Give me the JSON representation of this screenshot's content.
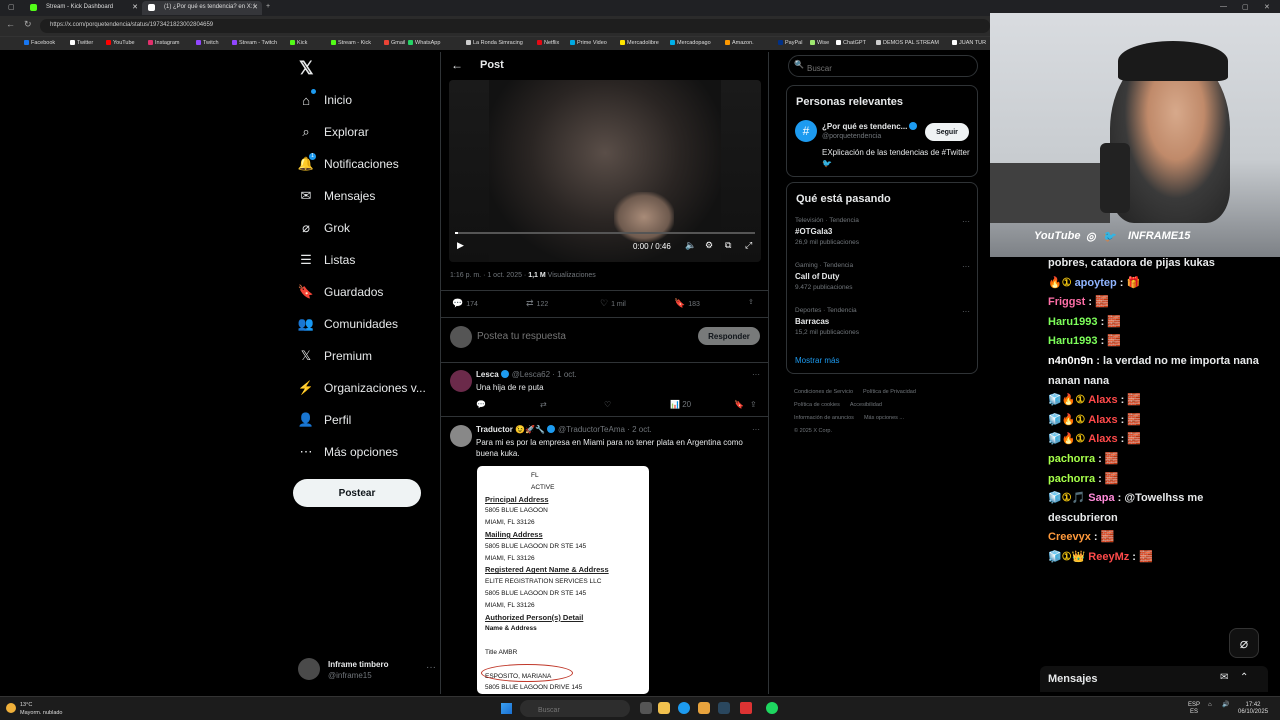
{
  "browser": {
    "tabs": [
      {
        "title": "Stream - Kick Dashboard",
        "favicon_color": "#53fc18"
      },
      {
        "title": "(1) ¿Por qué es tendencia? en X: '",
        "favicon_color": "#ffffff"
      }
    ],
    "url": "https://x.com/porquetendencia/status/1973421823002804659",
    "bookmarks": [
      {
        "label": "Facebook",
        "color": "#1877f2"
      },
      {
        "label": "Twitter",
        "color": "#ffffff"
      },
      {
        "label": "YouTube",
        "color": "#ff0000"
      },
      {
        "label": "Instagram",
        "color": "#e1306c"
      },
      {
        "label": "Twitch",
        "color": "#9146ff"
      },
      {
        "label": "Stream - Twitch",
        "color": "#9146ff"
      },
      {
        "label": "Kick",
        "color": "#53fc18"
      },
      {
        "label": "Stream - Kick",
        "color": "#53fc18"
      },
      {
        "label": "Gmail",
        "color": "#ea4335"
      },
      {
        "label": "WhatsApp",
        "color": "#25d366"
      },
      {
        "label": "La Ronda Simracing",
        "color": "#cccccc"
      },
      {
        "label": "Netflix",
        "color": "#e50914"
      },
      {
        "label": "Prime Video",
        "color": "#00a8e1"
      },
      {
        "label": "Mercadolibre",
        "color": "#ffe600"
      },
      {
        "label": "Mercadopago",
        "color": "#00b1ea"
      },
      {
        "label": "Amazon.",
        "color": "#ff9900"
      },
      {
        "label": "PayPal",
        "color": "#003087"
      },
      {
        "label": "Wise",
        "color": "#9fe870"
      },
      {
        "label": "ChatGPT",
        "color": "#ffffff"
      },
      {
        "label": "DEMOS PAL STREAM",
        "color": "#cccccc"
      },
      {
        "label": "JUAN TUR",
        "color": "#ffffff"
      }
    ]
  },
  "x_nav": {
    "items": [
      {
        "label": "Inicio",
        "icon": "home-icon"
      },
      {
        "label": "Explorar",
        "icon": "search-icon"
      },
      {
        "label": "Notificaciones",
        "icon": "bell-icon"
      },
      {
        "label": "Mensajes",
        "icon": "mail-icon"
      },
      {
        "label": "Grok",
        "icon": "grok-icon"
      },
      {
        "label": "Listas",
        "icon": "list-icon"
      },
      {
        "label": "Guardados",
        "icon": "bookmark-icon"
      },
      {
        "label": "Comunidades",
        "icon": "people-icon"
      },
      {
        "label": "Premium",
        "icon": "x-icon"
      },
      {
        "label": "Organizaciones v...",
        "icon": "lightning-icon"
      },
      {
        "label": "Perfil",
        "icon": "person-icon"
      },
      {
        "label": "Más opciones",
        "icon": "more-icon"
      }
    ],
    "notif_badge": "1",
    "post_button": "Postear",
    "account": {
      "name": "Inframe timbero",
      "handle": "@inframe15"
    }
  },
  "post": {
    "header_title": "Post",
    "video_time": "0:00 / 0:46",
    "video_progress": 0.0,
    "time_meta": "1:16 p. m. · 1 oct. 2025 · ",
    "views": "1,1 M",
    "views_label": " Visualizaciones",
    "stats": {
      "replies": "174",
      "retweets": "122",
      "likes": "1 mil",
      "bookmarks": "183"
    },
    "reply_placeholder": "Postea tu respuesta",
    "reply_button": "Responder"
  },
  "replies": [
    {
      "name": "Lesca",
      "handle": "@Lesca62 · 1 oct.",
      "text": "Una hija de re puta",
      "views": "20"
    },
    {
      "name": "Traductor 😉🚀🔧",
      "handle": "@TraductorTeAma · 2 oct.",
      "text": "Para mi es por la empresa en Miami para no tener plata en Argentina como buena kuka."
    }
  ],
  "doc_image": {
    "lines": [
      {
        "t": "FL",
        "s": "plain",
        "indent": true
      },
      {
        "t": "ACTIVE",
        "s": "plain",
        "indent": true
      },
      {
        "t": "Principal Address",
        "s": "h"
      },
      {
        "t": "5805 BLUE LAGOON",
        "s": "plain"
      },
      {
        "t": "MIAMI, FL 33126",
        "s": "plain"
      },
      {
        "t": "Mailing Address",
        "s": "h"
      },
      {
        "t": "5805 BLUE LAGOON DR STE 145",
        "s": "plain"
      },
      {
        "t": "MIAMI, FL 33126",
        "s": "plain"
      },
      {
        "t": "Registered Agent Name & Address",
        "s": "h"
      },
      {
        "t": "ELITE REGISTRATION SERVICES LLC",
        "s": "plain"
      },
      {
        "t": "5805 BLUE LAGOON DR STE 145",
        "s": "plain"
      },
      {
        "t": "MIAMI, FL 33126",
        "s": "plain"
      },
      {
        "t": "Authorized Person(s) Detail",
        "s": "h"
      },
      {
        "t": "Name & Address",
        "s": "b"
      },
      {
        "t": "",
        "s": "plain"
      },
      {
        "t": "Title AMBR",
        "s": "plain"
      },
      {
        "t": "",
        "s": "plain"
      },
      {
        "t": "ESPOSITO, MARIANA",
        "s": "plain"
      },
      {
        "t": "5805 BLUE LAGOON DRIVE 145",
        "s": "plain"
      }
    ]
  },
  "sidebar": {
    "search_placeholder": "Buscar",
    "relevant_title": "Personas relevantes",
    "relevant": {
      "name": "¿Por qué es tendenc...",
      "handle": "@porquetendencia",
      "bio": "EXplicación de las tendencias de #Twitter 🐦",
      "follow": "Seguir"
    },
    "trends_title": "Qué está pasando",
    "trends": [
      {
        "category": "Televisión · Tendencia",
        "name": "#OTGala3",
        "count": "26,9 mil publicaciones"
      },
      {
        "category": "Gaming · Tendencia",
        "name": "Call of Duty",
        "count": "9.472 publicaciones"
      },
      {
        "category": "Deportes · Tendencia",
        "name": "Barracas",
        "count": "15,2 mil publicaciones"
      }
    ],
    "show_more": "Mostrar más",
    "footer": [
      "Condiciones de Servicio",
      "Política de Privacidad",
      "Política de cookies",
      "Accesibilidad",
      "Información de anuncios",
      "Más opciones ...",
      "© 2025 X Corp."
    ]
  },
  "stream_overlay": {
    "bar_items": [
      "YouTube",
      "◎",
      "🐦",
      "INFRAME15"
    ]
  },
  "chat": {
    "messages": [
      {
        "user": "",
        "text": "pobres, catadora de pijas kukas",
        "color": "#ffffff",
        "badges": ""
      },
      {
        "user": "apoytep",
        "text": " : 🎁",
        "color": "#8fb4ff",
        "badges": "🔥①"
      },
      {
        "user": "Friggst",
        "text": " : 🧱",
        "color": "#ff6fa8",
        "badges": ""
      },
      {
        "user": "Haru1993",
        "text": " : 🧱",
        "color": "#7dff5a",
        "badges": ""
      },
      {
        "user": "Haru1993",
        "text": " : 🧱",
        "color": "#7dff5a",
        "badges": ""
      },
      {
        "user": "n4n0n9n",
        "text": " : la verdad no me importa nana",
        "color": "#ffffff",
        "badges": ""
      },
      {
        "user": "",
        "text": "nanan nana",
        "color": "#ffffff",
        "badges": ""
      },
      {
        "user": "Alaxs",
        "text": " : 🧱",
        "color": "#ff4a4a",
        "badges": "🧊🔥①"
      },
      {
        "user": "Alaxs",
        "text": " : 🧱",
        "color": "#ff4a4a",
        "badges": "🧊🔥①"
      },
      {
        "user": "Alaxs",
        "text": " : 🧱",
        "color": "#ff4a4a",
        "badges": "🧊🔥①"
      },
      {
        "user": "pachorra",
        "text": " : 🧱",
        "color": "#a6ff4a",
        "badges": ""
      },
      {
        "user": "pachorra",
        "text": " : 🧱",
        "color": "#a6ff4a",
        "badges": ""
      },
      {
        "user": "Sapa",
        "text": " : @Towelhss me",
        "color": "#ff8ad8",
        "badges": "🧊①🎵"
      },
      {
        "user": "",
        "text": "descubrieron",
        "color": "#ffffff",
        "badges": ""
      },
      {
        "user": "Creevyx",
        "text": " : 🧱",
        "color": "#ff9a3c",
        "badges": ""
      },
      {
        "user": "ReeyMz",
        "text": " : 🧱",
        "color": "#ff4a4a",
        "badges": "🧊①👑"
      }
    ],
    "footer_label": "Mensajes"
  },
  "taskbar": {
    "temp": "13°C",
    "weather": "Mayorm. nublado",
    "search": "Buscar",
    "lang": "ESP",
    "lang2": "ES",
    "time": "17:42",
    "date": "06/10/2025"
  }
}
